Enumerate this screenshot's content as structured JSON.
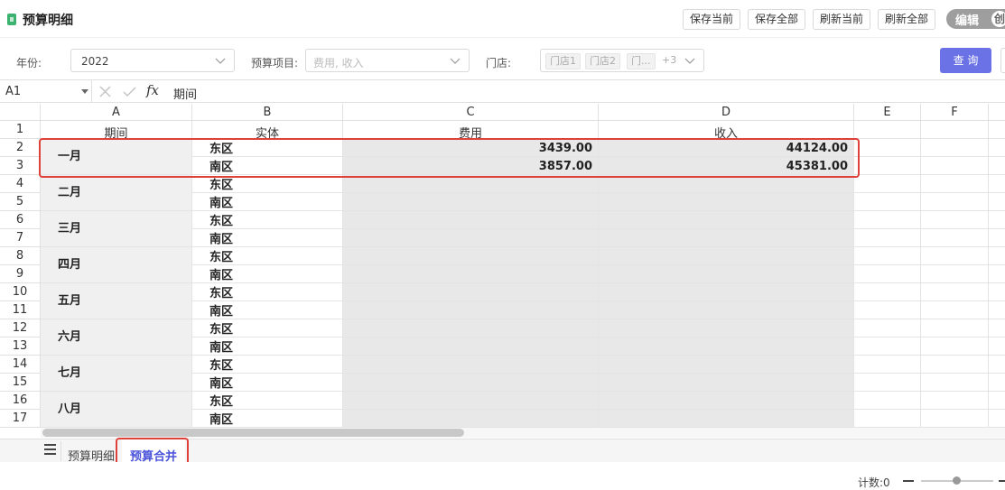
{
  "title": "预算明细",
  "toolbar": {
    "save_current": "保存当前",
    "save_all": "保存全部",
    "refresh_current": "刷新当前",
    "refresh_all": "刷新全部",
    "mode_label": "编辑",
    "mode_knob": "创"
  },
  "filters": {
    "year_label": "年份:",
    "year_value": "2022",
    "item_label": "预算项目:",
    "item_placeholder": "费用, 收入",
    "store_label": "门店:",
    "store_tags": [
      "门店1",
      "门店2",
      "门..."
    ],
    "store_more": "+3",
    "query_label": "查 询"
  },
  "formula_bar": {
    "cell_ref": "A1",
    "cancel_icon": "close-icon",
    "confirm_icon": "check-icon",
    "fx": "fx",
    "content": "期间"
  },
  "columns": [
    "A",
    "B",
    "C",
    "D",
    "E",
    "F"
  ],
  "rows": [
    "1",
    "2",
    "3",
    "4",
    "5",
    "6",
    "7",
    "8",
    "9",
    "10",
    "11",
    "12",
    "13",
    "14",
    "15",
    "16",
    "17"
  ],
  "table": {
    "headers": [
      "期间",
      "实体",
      "费用",
      "收入"
    ],
    "months": [
      "一月",
      "二月",
      "三月",
      "四月",
      "五月",
      "六月",
      "七月",
      "八月"
    ],
    "entities": [
      "东区",
      "南区"
    ],
    "values": [
      {
        "expense": "3439.00",
        "income": "44124.00"
      },
      {
        "expense": "3857.00",
        "income": "45381.00"
      }
    ]
  },
  "sheets": {
    "menu_icon": "hamburger-menu-icon",
    "tabs": [
      "预算明细",
      "预算合并"
    ],
    "active": "预算合并"
  },
  "status": {
    "count": "计数:0"
  },
  "colors": {
    "accent": "#6b72e6",
    "highlight": "#e0403a",
    "active_tab": "#4a53d9"
  }
}
